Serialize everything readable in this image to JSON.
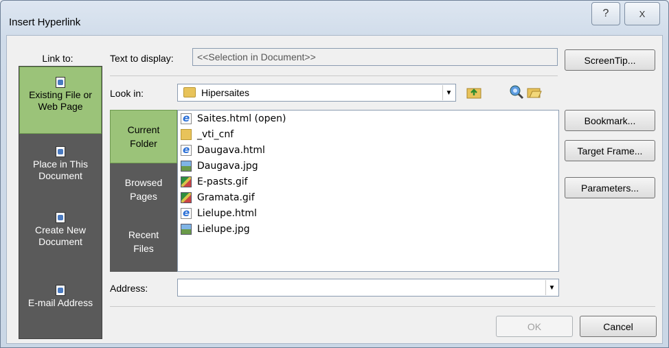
{
  "dialog": {
    "title": "Insert Hyperlink",
    "help_glyph": "?",
    "close_glyph": "X"
  },
  "link_to": {
    "label": "Link to:",
    "items": [
      {
        "l1": "Existing File or",
        "l2": "Web Page",
        "selected": true
      },
      {
        "l1": "Place in This",
        "l2": "Document",
        "selected": false
      },
      {
        "l1": "Create New",
        "l2": "Document",
        "selected": false
      },
      {
        "l1": "E-mail Address",
        "l2": "",
        "selected": false
      }
    ]
  },
  "text_to_display": {
    "label": "Text to display:",
    "value": "<<Selection in Document>>"
  },
  "look_in": {
    "label": "Look in:",
    "value": "Hipersaites"
  },
  "tabs": [
    {
      "l1": "Current",
      "l2": "Folder",
      "selected": true
    },
    {
      "l1": "Browsed",
      "l2": "Pages",
      "selected": false
    },
    {
      "l1": "Recent",
      "l2": "Files",
      "selected": false
    }
  ],
  "files": [
    {
      "name": "Saites.html (open)",
      "type": "html"
    },
    {
      "name": "_vti_cnf",
      "type": "folder"
    },
    {
      "name": "Daugava.html",
      "type": "html"
    },
    {
      "name": "Daugava.jpg",
      "type": "jpg"
    },
    {
      "name": "E-pasts.gif",
      "type": "gif"
    },
    {
      "name": "Gramata.gif",
      "type": "gif"
    },
    {
      "name": "Lielupe.html",
      "type": "html"
    },
    {
      "name": "Lielupe.jpg",
      "type": "jpg"
    }
  ],
  "address": {
    "label": "Address:",
    "value": ""
  },
  "buttons": {
    "screentip": "ScreenTip...",
    "bookmark": "Bookmark...",
    "target_frame": "Target Frame...",
    "parameters": "Parameters...",
    "ok": "OK",
    "cancel": "Cancel"
  },
  "colors": {
    "sidebar_bg": "#5a5a5a",
    "selected_bg": "#9bc379"
  }
}
